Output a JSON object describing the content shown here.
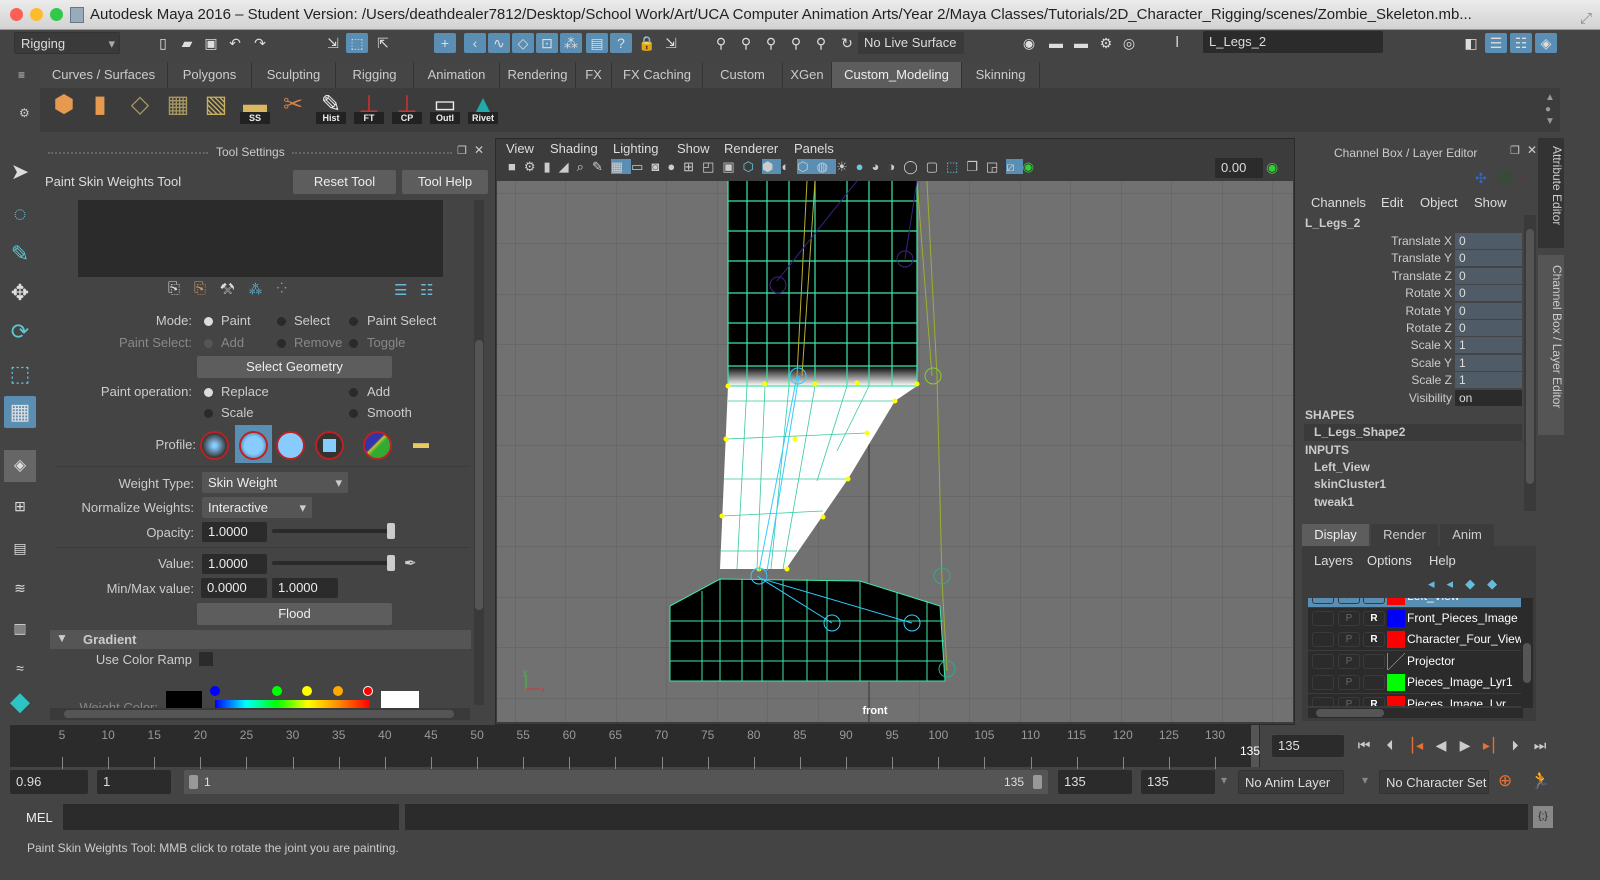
{
  "title": "Autodesk Maya 2016 – Student Version: /Users/deathdealer7812/Desktop/School Work/Art/UCA Computer Animation Arts/Year 2/Maya Classes/Tutorials/2D_Character_Rigging/scenes/Zombie_Skeleton.mb...",
  "status_line": {
    "menu_set": "Rigging",
    "live_surface": "No Live Surface",
    "selection_field": "L_Legs_2",
    "icons": [
      "new-scene",
      "open-scene",
      "save-scene",
      "undo",
      "redo",
      "select-hierarchy",
      "select-object",
      "select-component",
      "snap-grid",
      "snap-curve",
      "snap-point",
      "snap-view-plane",
      "snap-live",
      "snap-surface",
      "snap-uv",
      "snap-help",
      "lock",
      "select-tool",
      "history-1",
      "history-2",
      "history-3",
      "history-4",
      "history-5",
      "history-6",
      "render-view",
      "render",
      "ipr-render",
      "render-settings",
      "hypershade"
    ]
  },
  "shelf": {
    "tabs": [
      "Curves / Surfaces",
      "Polygons",
      "Sculpting",
      "Rigging",
      "Animation",
      "Rendering",
      "FX",
      "FX Caching",
      "Custom",
      "XGen",
      "Custom_Modeling",
      "Skinning"
    ],
    "active_tab": "Custom_Modeling",
    "items": [
      {
        "icon": "cube-icon",
        "label": ""
      },
      {
        "icon": "extrude-icon",
        "label": ""
      },
      {
        "icon": "subdivide-icon",
        "label": ""
      },
      {
        "icon": "delete-lattice-icon",
        "label": ""
      },
      {
        "icon": "insert-edge-loop-icon",
        "label": ""
      },
      {
        "icon": "folder-icon",
        "label": "SS"
      },
      {
        "icon": "knife-icon",
        "label": ""
      },
      {
        "icon": "history-icon",
        "label": "Hist"
      },
      {
        "icon": "freeze-transform-icon",
        "label": "FT"
      },
      {
        "icon": "center-pivot-icon",
        "label": "CP"
      },
      {
        "icon": "outliner-icon",
        "label": "Outl"
      },
      {
        "icon": "rivet-icon",
        "label": "Rivet"
      }
    ]
  },
  "tool_settings": {
    "panel_title": "Tool Settings",
    "tool_name": "Paint Skin Weights Tool",
    "reset": "Reset Tool",
    "help": "Tool Help",
    "mode_label": "Mode:",
    "mode_options": [
      "Paint",
      "Select",
      "Paint Select"
    ],
    "mode_selected": "Paint",
    "paint_select_label": "Paint Select:",
    "paint_select_options": [
      "Add",
      "Remove",
      "Toggle"
    ],
    "select_geometry": "Select Geometry",
    "paint_op_label": "Paint operation:",
    "paint_op_options": [
      "Replace",
      "Add",
      "Scale",
      "Smooth"
    ],
    "paint_op_selected": "Replace",
    "profile_label": "Profile:",
    "weight_type_label": "Weight Type:",
    "weight_type": "Skin Weight",
    "normalize_label": "Normalize Weights:",
    "normalize": "Interactive",
    "opacity_label": "Opacity:",
    "opacity": "1.0000",
    "value_label": "Value:",
    "value": "1.0000",
    "minmax_label": "Min/Max value:",
    "min": "0.0000",
    "max": "1.0000",
    "flood": "Flood",
    "gradient": "Gradient",
    "use_color_ramp": "Use Color Ramp",
    "weight_color": "Weight Color:"
  },
  "viewport": {
    "menus": [
      "View",
      "Shading",
      "Lighting",
      "Show",
      "Renderer",
      "Panels"
    ],
    "exposure": "0.00",
    "camera": "front"
  },
  "channel_box": {
    "title": "Channel Box / Layer Editor",
    "menus": [
      "Channels",
      "Edit",
      "Object",
      "Show"
    ],
    "object": "L_Legs_2",
    "channels": [
      {
        "name": "Translate X",
        "value": "0"
      },
      {
        "name": "Translate Y",
        "value": "0"
      },
      {
        "name": "Translate Z",
        "value": "0"
      },
      {
        "name": "Rotate X",
        "value": "0"
      },
      {
        "name": "Rotate Y",
        "value": "0"
      },
      {
        "name": "Rotate Z",
        "value": "0"
      },
      {
        "name": "Scale X",
        "value": "1"
      },
      {
        "name": "Scale Y",
        "value": "1"
      },
      {
        "name": "Scale Z",
        "value": "1"
      },
      {
        "name": "Visibility",
        "value": "on"
      }
    ],
    "shapes_header": "SHAPES",
    "shape": "L_Legs_Shape2",
    "inputs_header": "INPUTS",
    "inputs": [
      "Left_View",
      "skinCluster1",
      "tweak1"
    ],
    "side_tabs": [
      "Attribute Editor",
      "Channel Box / Layer Editor"
    ]
  },
  "layer_editor": {
    "tabs": [
      "Display",
      "Render",
      "Anim"
    ],
    "menus": [
      "Layers",
      "Options",
      "Help"
    ],
    "layers": [
      {
        "name": "Left_View",
        "color": "#ff0000",
        "r": "",
        "selected": true
      },
      {
        "name": "Front_Pieces_Image",
        "color": "#0000ff",
        "r": "R",
        "selected": false
      },
      {
        "name": "Character_Four_View",
        "color": "#ff0000",
        "r": "R",
        "selected": false
      },
      {
        "name": "Projector",
        "color": "",
        "r": "",
        "selected": false
      },
      {
        "name": "Pieces_Image_Lyr1",
        "color": "#00ff00",
        "r": "",
        "selected": false
      },
      {
        "name": "Pieces_Image_Lyr",
        "color": "#ff0000",
        "r": "R",
        "selected": false
      }
    ]
  },
  "timeline": {
    "ticks": [
      5,
      10,
      15,
      20,
      25,
      30,
      35,
      40,
      45,
      50,
      55,
      60,
      65,
      70,
      75,
      80,
      85,
      90,
      95,
      100,
      105,
      110,
      115,
      120,
      125,
      130
    ],
    "current_frame": "135",
    "current_field": "135"
  },
  "range": {
    "playback_speed": "0.96",
    "start": "1",
    "range_start": "1",
    "range_end": "135",
    "end": "135",
    "end2": "135",
    "anim_layer": "No Anim Layer",
    "character_set": "No Character Set"
  },
  "command_line": {
    "label": "MEL"
  },
  "help_line": "Paint Skin Weights Tool: MMB click to rotate the joint you are painting."
}
